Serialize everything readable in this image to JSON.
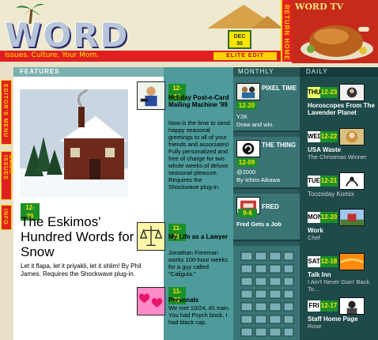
{
  "header": {
    "logo_text": "WORD",
    "date_badge": "DEC\n30",
    "tagline": "Issues. Culture. Your Mom.",
    "edit_label": "ELITE EDIT",
    "vertical_tab": "RETURN HOME",
    "wordtv_label": "WORD TV"
  },
  "left_tabs": [
    "EDITOR'S MENU",
    "BACK ISSUES",
    "INFO"
  ],
  "features": {
    "header": "FEATURES",
    "date": "12-20",
    "title": "The Eskimos' Hundred Words for Snow",
    "description": "Let it flapa, let it priyakli, let it shlim! By Phil James. Requires the Shockwave plug-in."
  },
  "middle": [
    {
      "date": "12-13",
      "title": "Holiday Post-e-Card Mailing Machine '99",
      "description": "Now is the time to send happy seasonal greetings to all of your friends and associates! Fully personalized and free of charge for two whole weeks of deluxe seasonal pleasure. Requires the Shockwave plug-in."
    },
    {
      "date": "11-29",
      "title": "My Life as a Lawyer",
      "description": "Jonathan Foreman works 100-hour weeks for a guy called \"Caligula.\""
    },
    {
      "date": "11-22",
      "title": "Personals",
      "description": "We met 10/24, #1 train. You had Psych book, I had black cap."
    }
  ],
  "monthly": {
    "header": "MONTHLY",
    "items": [
      {
        "date": "12-20",
        "title": "PIXEL TIME",
        "subtitle": "Y2K",
        "description": "Draw and win."
      },
      {
        "date": "12-09",
        "title": "THE THING",
        "subtitle": "@2000",
        "description": "By Ichiro Aikawa"
      },
      {
        "date": "9-6",
        "title": "FRED",
        "subtitle": "",
        "description": "Fred Gets a Job"
      }
    ]
  },
  "daily": {
    "header": "DAILY",
    "items": [
      {
        "day": "THU",
        "date": "12-23",
        "title": "Horoscopes From The Lavender Planet",
        "description": ""
      },
      {
        "day": "WED",
        "date": "12-22",
        "title": "USA Waste",
        "description": "The Christmas Winner"
      },
      {
        "day": "TUE",
        "date": "12-21",
        "title": "Toozeday Komix",
        "description": ""
      },
      {
        "day": "MON",
        "date": "12-20",
        "title": "Work",
        "description": "Chef"
      },
      {
        "day": "SAT",
        "date": "12-18",
        "title": "Talk Inn",
        "description": "I Ain't Never Goin' Back To..."
      },
      {
        "day": "FRI",
        "date": "12-17",
        "title": "Staff Home Page",
        "description": "Rose"
      }
    ]
  },
  "colors": {
    "accent_red": "#e02020",
    "accent_yellow": "#ffd200",
    "date_green": "#1a8f2a",
    "teal": "#4d9b9b",
    "dark_teal": "#1f4a4a"
  }
}
